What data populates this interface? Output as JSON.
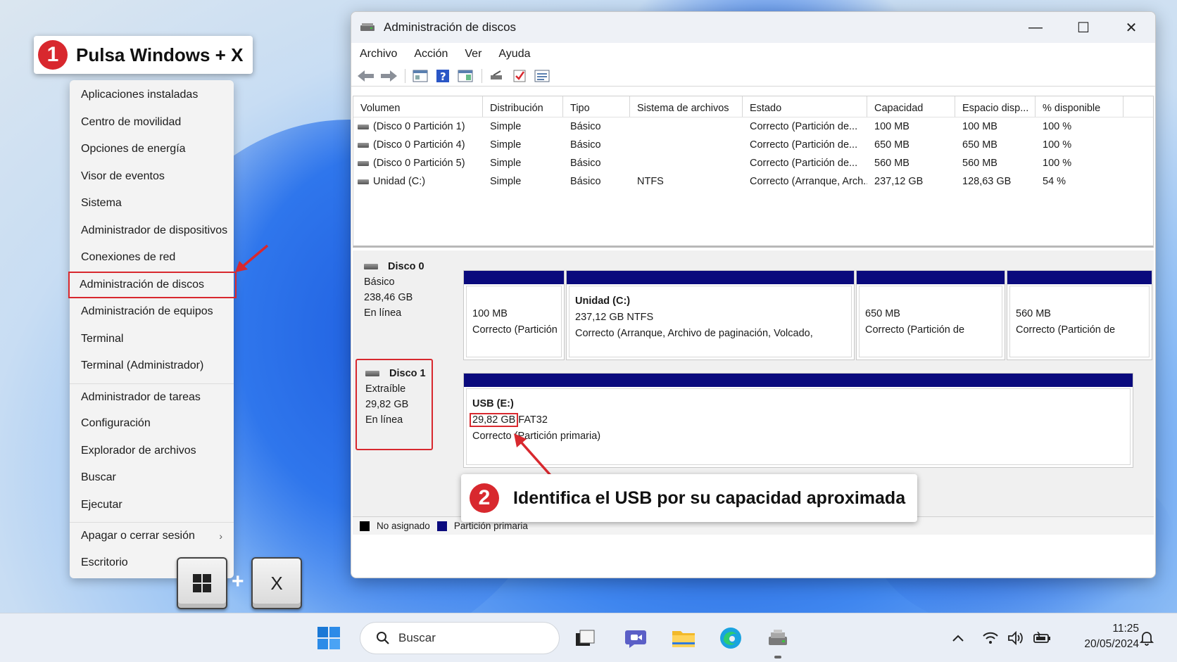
{
  "callouts": {
    "step1": {
      "num": "1",
      "text": "Pulsa Windows + X"
    },
    "step2": {
      "num": "2",
      "text": "Identifica el USB por su capacidad aproximada"
    }
  },
  "winx_menu": {
    "items": [
      "Aplicaciones instaladas",
      "Centro de movilidad",
      "Opciones de energía",
      "Visor de eventos",
      "Sistema",
      "Administrador de dispositivos",
      "Conexiones de red",
      "Administración de discos",
      "Administración de equipos",
      "Terminal",
      "Terminal (Administrador)",
      "Administrador de tareas",
      "Configuración",
      "Explorador de archivos",
      "Buscar",
      "Ejecutar",
      "Apagar o cerrar sesión",
      "Escritorio"
    ],
    "submenu_chevron": "›"
  },
  "keys": {
    "x_key": "X",
    "plus": "+"
  },
  "window": {
    "title": "Administración de discos",
    "controls": {
      "minimize": "—",
      "maximize": "☐",
      "close": "✕"
    },
    "menu": [
      "Archivo",
      "Acción",
      "Ver",
      "Ayuda"
    ],
    "toolbar_icons": [
      "back-arrow-icon",
      "forward-arrow-icon",
      "properties-icon",
      "help-icon",
      "show-hide-icon",
      "connect-icon",
      "check-icon",
      "list-icon"
    ]
  },
  "volumes": {
    "columns": [
      "Volumen",
      "Distribución",
      "Tipo",
      "Sistema de archivos",
      "Estado",
      "Capacidad",
      "Espacio disp...",
      "% disponible"
    ],
    "rows": [
      [
        "(Disco 0 Partición 1)",
        "Simple",
        "Básico",
        "",
        "Correcto (Partición de...",
        "100 MB",
        "100 MB",
        "100 %"
      ],
      [
        "(Disco 0 Partición 4)",
        "Simple",
        "Básico",
        "",
        "Correcto (Partición de...",
        "650 MB",
        "650 MB",
        "100 %"
      ],
      [
        "(Disco 0 Partición 5)",
        "Simple",
        "Básico",
        "",
        "Correcto (Partición de...",
        "560 MB",
        "560 MB",
        "100 %"
      ],
      [
        "Unidad  (C:)",
        "Simple",
        "Básico",
        "NTFS",
        "Correcto (Arranque, Arch...",
        "237,12 GB",
        "128,63 GB",
        "54 %"
      ]
    ]
  },
  "disks": {
    "disk0": {
      "name": "Disco 0",
      "type": "Básico",
      "size": "238,46 GB",
      "status": "En línea",
      "partitions": [
        {
          "name": "",
          "line1": "100 MB",
          "line2": "Correcto (Partición"
        },
        {
          "name": "Unidad  (C:)",
          "line1": "237,12 GB NTFS",
          "line2": "Correcto (Arranque, Archivo de paginación, Volcado,"
        },
        {
          "name": "",
          "line1": "650 MB",
          "line2": "Correcto (Partición de"
        },
        {
          "name": "",
          "line1": "560 MB",
          "line2": "Correcto (Partición de"
        }
      ]
    },
    "disk1": {
      "name": "Disco 1",
      "type": "Extraíble",
      "size": "29,82 GB",
      "status": "En línea",
      "partition": {
        "name": "USB  (E:)",
        "capacity": "29,82 GB",
        "fs": "FAT32",
        "status": "Correcto (Partición primaria)"
      }
    }
  },
  "legend": {
    "unallocated": "No asignado",
    "primary": "Partición primaria",
    "unallocated_color": "#000000",
    "primary_color": "#0a0a7d"
  },
  "taskbar": {
    "search_placeholder": "Buscar",
    "time": "11:25",
    "date": "20/05/2024",
    "icons": [
      "windows-start-icon",
      "search-icon",
      "task-view-icon",
      "chat-icon",
      "file-explorer-icon",
      "edge-icon",
      "disk-management-icon"
    ],
    "tray": [
      "chevron-up-icon",
      "wifi-icon",
      "volume-icon",
      "battery-icon",
      "notification-bell-icon"
    ]
  },
  "colors": {
    "accent_red": "#d8282e",
    "partition_band": "#0a0a7d"
  }
}
